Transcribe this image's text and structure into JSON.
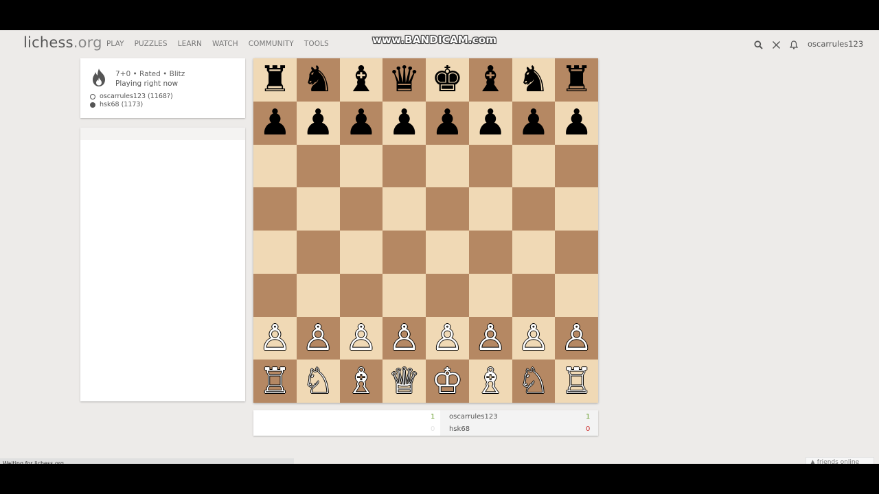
{
  "header": {
    "logo_main": "lichess",
    "logo_tld": ".org",
    "nav": [
      "PLAY",
      "PUZZLES",
      "LEARN",
      "WATCH",
      "COMMUNITY",
      "TOOLS"
    ],
    "watermark": "www.BANDICAM.com",
    "icons": [
      "search-icon",
      "swords-icon",
      "bell-icon"
    ],
    "username": "oscarrules123"
  },
  "game_info": {
    "setup": "7+0 • Rated • Blitz",
    "status": "Playing right now",
    "players": [
      "oscarrules123 (1168?)",
      "hsk68 (1173)"
    ]
  },
  "board": {
    "orientation": "white",
    "colors": {
      "light": "#f0d9b5",
      "dark": "#b58863"
    },
    "rows": [
      [
        "♜",
        "♞",
        "♝",
        "♛",
        "♚",
        "♝",
        "♞",
        "♜"
      ],
      [
        "♟",
        "♟",
        "♟",
        "♟",
        "♟",
        "♟",
        "♟",
        "♟"
      ],
      [
        "",
        "",
        "",
        "",
        "",
        "",
        "",
        ""
      ],
      [
        "",
        "",
        "",
        "",
        "",
        "",
        "",
        ""
      ],
      [
        "",
        "",
        "",
        "",
        "",
        "",
        "",
        ""
      ],
      [
        "",
        "",
        "",
        "",
        "",
        "",
        "",
        ""
      ],
      [
        "♙",
        "♙",
        "♙",
        "♙",
        "♙",
        "♙",
        "♙",
        "♙"
      ],
      [
        "♖",
        "♘",
        "♗",
        "♕",
        "♔",
        "♗",
        "♘",
        "♖"
      ]
    ]
  },
  "score": {
    "left_top": "1",
    "left_bottom": "0",
    "players": [
      {
        "name": "oscarrules123",
        "score": "1"
      },
      {
        "name": "hsk68",
        "score": "0"
      }
    ]
  },
  "footer": {
    "status": "Waiting for lichess.org...",
    "friends": "▲ friends online"
  }
}
